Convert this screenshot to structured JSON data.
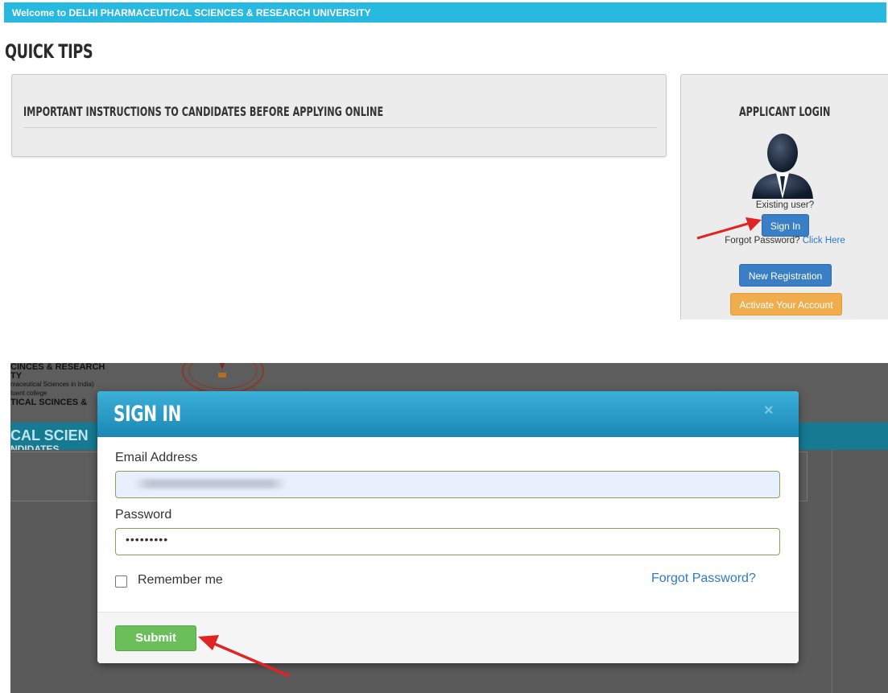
{
  "top_panel": {
    "welcome_text": "Welcome to DELHI PHARMACEUTICAL SCIENCES & RESEARCH UNIVERSITY",
    "section_title": "QUICK TIPS",
    "instructions_title": "IMPORTANT INSTRUCTIONS TO CANDIDATES BEFORE APPLYING ONLINE",
    "login": {
      "title": "APPLICANT LOGIN",
      "existing_user": "Existing user?",
      "sign_in_label": "Sign In",
      "forgot_prefix": "Forgot Password?",
      "forgot_link": "Click Here",
      "new_registration_label": "New Registration",
      "activate_label": "Activate Your Account"
    }
  },
  "background_page": {
    "header_lines": [
      "CINCES & RESEARCH",
      "TY",
      "maceutical Sciences in India)",
      "tuent college",
      "TICAL SCINCES &"
    ],
    "nav_text": "CAL SCIEN",
    "subtext": "NDIDATES"
  },
  "modal": {
    "title": "SIGN IN",
    "close_glyph": "×",
    "email_label": "Email Address",
    "password_label": "Password",
    "password_value": "•••••••••",
    "remember_label": "Remember me",
    "forgot_label": "Forgot Password?",
    "submit_label": "Submit"
  },
  "colors": {
    "welcome_bar": "#27b9e0",
    "primary_button": "#3a7fc5",
    "warning_button": "#f0ad4e",
    "submit_button": "#6bbf5a",
    "annotation_arrow": "#e02424"
  },
  "icons": [
    "user-avatar-icon",
    "close-icon",
    "annotation-arrow"
  ]
}
